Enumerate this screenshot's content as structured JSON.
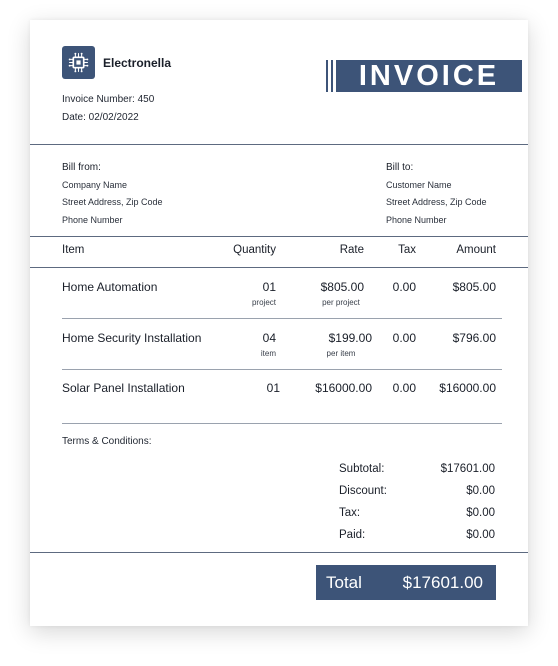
{
  "company": {
    "name": "Electronella"
  },
  "invoice": {
    "title": "INVOICE",
    "number_label": "Invoice Number: 450",
    "date_label": "Date: 02/02/2022"
  },
  "bill_from": {
    "label": "Bill from:",
    "lines": [
      "Company Name",
      "Street Address, Zip Code",
      "Phone Number"
    ]
  },
  "bill_to": {
    "label": "Bill to:",
    "lines": [
      "Customer Name",
      "Street Address, Zip Code",
      "Phone Number"
    ]
  },
  "table": {
    "headers": {
      "item": "Item",
      "quantity": "Quantity",
      "rate": "Rate",
      "tax": "Tax",
      "amount": "Amount"
    },
    "rows": [
      {
        "item": "Home Automation",
        "quantity": "01",
        "quantity_unit": "project",
        "rate": "$805.00",
        "rate_unit": "per project",
        "tax": "0.00",
        "amount": "$805.00"
      },
      {
        "item": "Home Security Installation",
        "quantity": "04",
        "quantity_unit": "item",
        "rate": "$199.00",
        "rate_unit": "per item",
        "tax": "0.00",
        "amount": "$796.00"
      },
      {
        "item": "Solar Panel Installation",
        "quantity": "01",
        "quantity_unit": "",
        "rate": "$16000.00",
        "rate_unit": "",
        "tax": "0.00",
        "amount": "$16000.00"
      }
    ]
  },
  "terms": {
    "label": "Terms & Conditions:"
  },
  "summary": {
    "subtotal_label": "Subtotal:",
    "subtotal_value": "$17601.00",
    "discount_label": "Discount:",
    "discount_value": "$0.00",
    "tax_label": "Tax:",
    "tax_value": "$0.00",
    "paid_label": "Paid:",
    "paid_value": "$0.00"
  },
  "total": {
    "label": "Total",
    "value": "$17601.00"
  },
  "colors": {
    "accent": "#3d5478",
    "text": "#1a1f29",
    "rule": "#5d6a80"
  },
  "icons": {
    "logo": "circuit-chip-icon"
  }
}
